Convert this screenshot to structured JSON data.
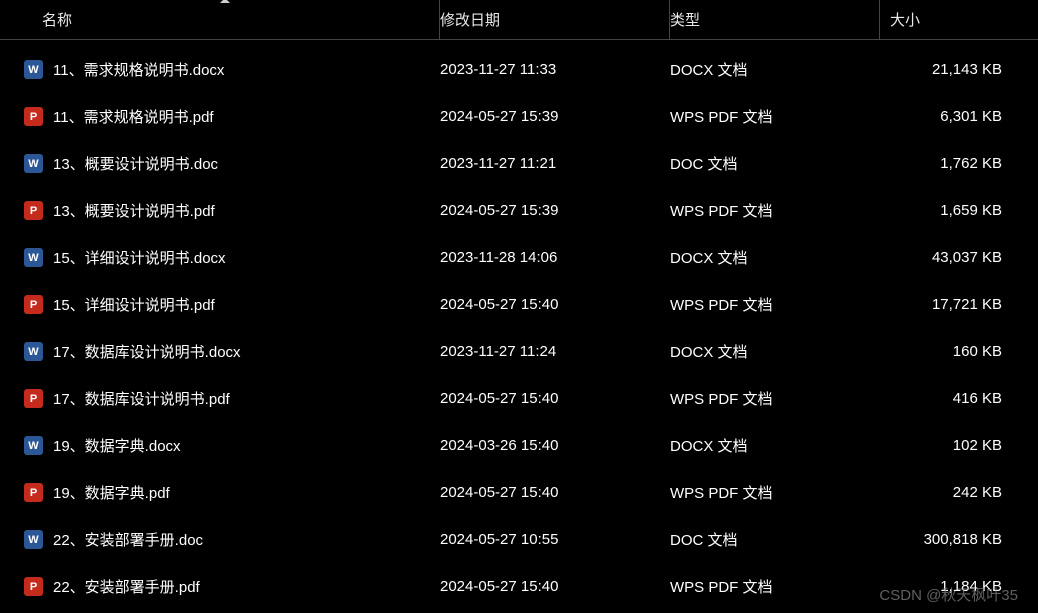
{
  "columns": {
    "name": "名称",
    "date": "修改日期",
    "type": "类型",
    "size": "大小"
  },
  "files": [
    {
      "icon": "docx",
      "iconText": "W",
      "name": "11、需求规格说明书.docx",
      "date": "2023-11-27 11:33",
      "type": "DOCX 文档",
      "size": "21,143 KB"
    },
    {
      "icon": "pdf",
      "iconText": "P",
      "name": "11、需求规格说明书.pdf",
      "date": "2024-05-27 15:39",
      "type": "WPS PDF 文档",
      "size": "6,301 KB"
    },
    {
      "icon": "doc",
      "iconText": "W",
      "name": "13、概要设计说明书.doc",
      "date": "2023-11-27 11:21",
      "type": "DOC 文档",
      "size": "1,762 KB"
    },
    {
      "icon": "pdf",
      "iconText": "P",
      "name": "13、概要设计说明书.pdf",
      "date": "2024-05-27 15:39",
      "type": "WPS PDF 文档",
      "size": "1,659 KB"
    },
    {
      "icon": "docx",
      "iconText": "W",
      "name": "15、详细设计说明书.docx",
      "date": "2023-11-28 14:06",
      "type": "DOCX 文档",
      "size": "43,037 KB"
    },
    {
      "icon": "pdf",
      "iconText": "P",
      "name": "15、详细设计说明书.pdf",
      "date": "2024-05-27 15:40",
      "type": "WPS PDF 文档",
      "size": "17,721 KB"
    },
    {
      "icon": "docx",
      "iconText": "W",
      "name": "17、数据库设计说明书.docx",
      "date": "2023-11-27 11:24",
      "type": "DOCX 文档",
      "size": "160 KB"
    },
    {
      "icon": "pdf",
      "iconText": "P",
      "name": "17、数据库设计说明书.pdf",
      "date": "2024-05-27 15:40",
      "type": "WPS PDF 文档",
      "size": "416 KB"
    },
    {
      "icon": "docx",
      "iconText": "W",
      "name": "19、数据字典.docx",
      "date": "2024-03-26 15:40",
      "type": "DOCX 文档",
      "size": "102 KB"
    },
    {
      "icon": "pdf",
      "iconText": "P",
      "name": "19、数据字典.pdf",
      "date": "2024-05-27 15:40",
      "type": "WPS PDF 文档",
      "size": "242 KB"
    },
    {
      "icon": "doc",
      "iconText": "W",
      "name": "22、安装部署手册.doc",
      "date": "2024-05-27 10:55",
      "type": "DOC 文档",
      "size": "300,818 KB"
    },
    {
      "icon": "pdf",
      "iconText": "P",
      "name": "22、安装部署手册.pdf",
      "date": "2024-05-27 15:40",
      "type": "WPS PDF 文档",
      "size": "1,184 KB"
    }
  ],
  "watermark": "CSDN @秋天枫叶35"
}
